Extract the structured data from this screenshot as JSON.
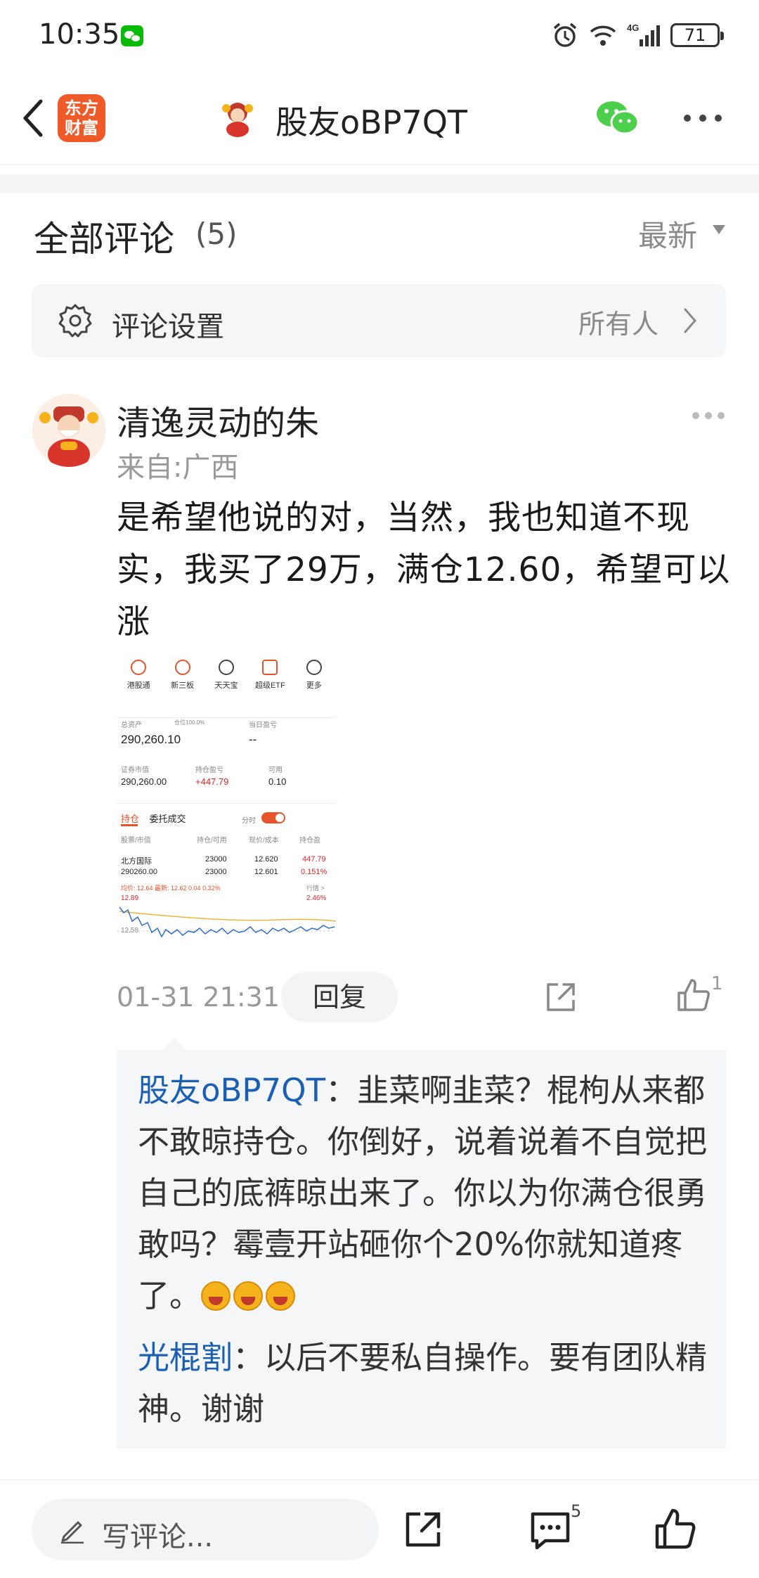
{
  "status_bar": {
    "time": "10:35",
    "network": "4G",
    "battery": "71"
  },
  "header": {
    "app_logo_text": "东方财富",
    "title": "股友oBP7QT"
  },
  "comments_section": {
    "title": "全部评论",
    "count": "(5)",
    "sort": "最新"
  },
  "settings": {
    "label": "评论设置",
    "value": "所有人"
  },
  "comment": {
    "author": "清逸灵动的朱",
    "location": "来自:广西",
    "text": "是希望他说的对，当然，我也知道不现实，我买了29万，满仓12.60，希望可以涨",
    "time": "01-31 21:31",
    "reply_label": "回复",
    "like_count": "1",
    "screenshot": {
      "icons": [
        "港股通",
        "新三板",
        "天天宝",
        "超级ETF",
        "更多"
      ],
      "total_assets_label": "总资产",
      "position_ratio": "仓位100.0%",
      "total_assets": "290,260.10",
      "daily_pnl_label": "当日盈亏",
      "daily_pnl": "--",
      "market_value_label": "证券市值",
      "market_value": "290,260.00",
      "holding_pnl_label": "持仓盈亏",
      "holding_pnl": "+447.79",
      "available_label": "可用",
      "available": "0.10",
      "tab_positions": "持仓",
      "tab_orders": "委托成交",
      "intraday_label": "分时",
      "col_stock": "股票/市值",
      "col_hold": "持仓/可用",
      "col_price": "现价/成本",
      "col_pnl": "持仓盈",
      "stock_name": "北方国际",
      "stock_value": "290260.00",
      "hold": "23000",
      "available_qty": "23000",
      "price": "12.620",
      "cost": "12.601",
      "pnl": "447.79",
      "pnl_pct": "0.151%",
      "quote_line": "均价: 12.64  最新: 12.62  0.04  0.32%",
      "quote_link": "行情 >",
      "high": "12.89",
      "high_pct": "2.46%",
      "mid": "12.58"
    }
  },
  "replies": [
    {
      "author": "股友oBP7QT",
      "text": "：韭菜啊韭菜？棍枸从来都不敢晾持仓。你倒好，说着说着不自觉把自己的底裤晾出来了。你以为你满仓很勇敢吗？霉壹开站砸你个20%你就知道疼了。"
    },
    {
      "author": "光棍割",
      "text": "：以后不要私自操作。要有团队精神。谢谢"
    }
  ],
  "bottom_bar": {
    "input_placeholder": "写评论...",
    "comment_count": "5"
  },
  "colors": {
    "accent": "#f05a28",
    "link": "#1a5fb4",
    "red": "#e0242a",
    "muted": "#999999"
  }
}
